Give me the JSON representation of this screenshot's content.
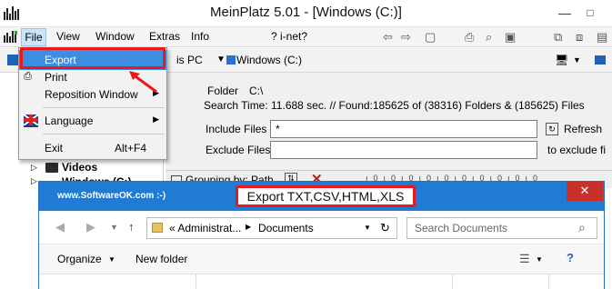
{
  "window": {
    "title": "MeinPlatz 5.01 - [Windows (C:)]",
    "min_glyph": "—",
    "max_glyph": "□"
  },
  "menubar": {
    "items": [
      "File",
      "View",
      "Window",
      "Extras",
      "Info"
    ],
    "help_label": "? i-net?"
  },
  "address": {
    "this_pc_label": "is PC",
    "drive_label": "Windows (C:)"
  },
  "search_panel": {
    "folder_label": "Folder",
    "folder_value": "C:\\",
    "stats": "Search Time: 11.688 sec. //  Found:185625 of (38316) Folders & (185625) Files",
    "include_label": "Include Files",
    "include_value": "*",
    "refresh_label": "Refresh",
    "exclude_label": "Exclude Files",
    "exclude_value": "",
    "exclude_hint": "to exclude fi",
    "grouping_label": "Grouping by: Path"
  },
  "tree": {
    "nodes": [
      "Videos",
      "Windows (C:)"
    ]
  },
  "file_menu": {
    "export": "Export",
    "print": "Print",
    "reposition": "Reposition Window",
    "language": "Language",
    "exit": "Exit",
    "exit_shortcut": "Alt+F4"
  },
  "explorer": {
    "watermark": "www.SoftwareOK.com :-)",
    "title": "Export TXT,CSV,HTML,XLS",
    "close_glyph": "✕",
    "breadcrumb": [
      "«  Administrat...",
      "Documents"
    ],
    "search_placeholder": "Search Documents",
    "organize_label": "Organize",
    "new_folder_label": "New folder"
  },
  "colors": {
    "highlight_red": "#e8181b",
    "menu_selected": "#3d8ee0",
    "explorer_title": "#1f7bd3"
  }
}
